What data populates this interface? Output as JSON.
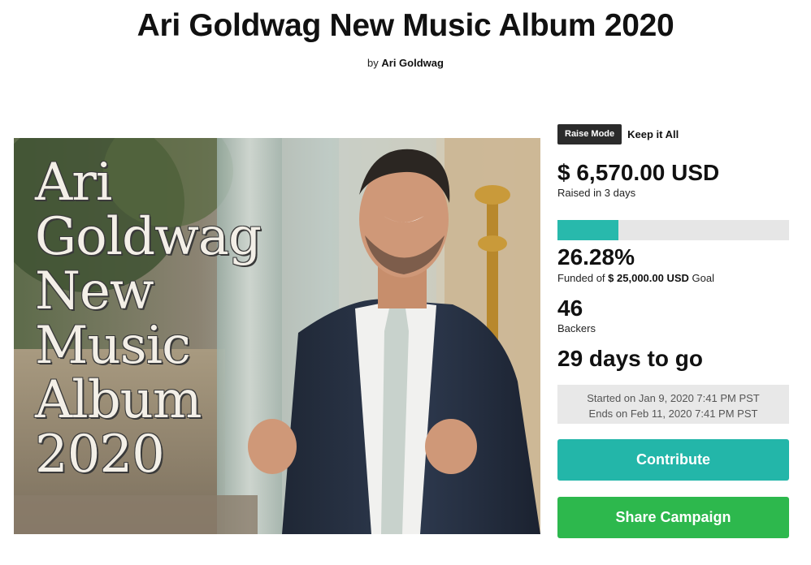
{
  "campaign": {
    "title": "Ari Goldwag New Music Album 2020",
    "by_prefix": "by",
    "author": "Ari Goldwag"
  },
  "hero_image": {
    "text_lines": [
      "Ari",
      "Goldwag",
      "New",
      "Music",
      "Album",
      "2020"
    ]
  },
  "stats": {
    "raise_mode_label": "Raise Mode",
    "raise_mode_value": "Keep it All",
    "raised_amount": "$ 6,570.00 USD",
    "raised_period": "Raised in 3 days",
    "funded_fraction": 0.2628,
    "funded_percent": "26.28%",
    "goal_prefix": "Funded of",
    "goal_amount": "$ 25,000.00 USD",
    "goal_suffix": "Goal",
    "backers_count": "46",
    "backers_label": "Backers",
    "days_to_go": "29 days to go",
    "started": "Started on Jan 9, 2020 7:41 PM PST",
    "ends": "Ends on Feb 11, 2020 7:41 PM PST"
  },
  "actions": {
    "contribute_label": "Contribute",
    "share_label": "Share Campaign"
  },
  "colors": {
    "progress_fill": "#28b9ac",
    "contribute_button": "#23b6a9",
    "share_button": "#2db84d",
    "mode_badge": "#2b2b2b"
  }
}
